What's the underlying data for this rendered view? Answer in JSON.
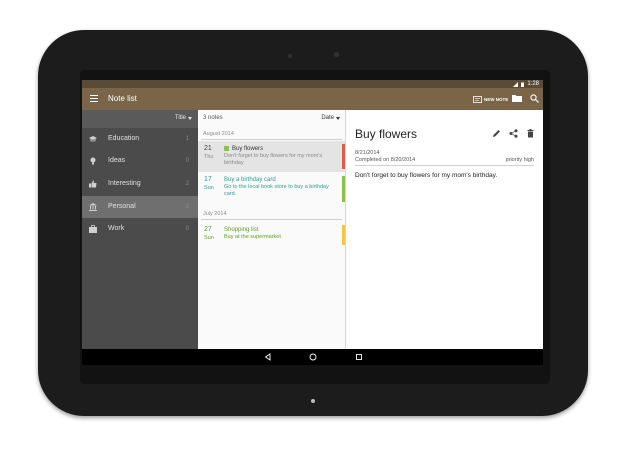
{
  "colors": {
    "status_bar": "#5a4b36",
    "app_bar": "#7a6548",
    "sidebar_bg": "#4b4b4b",
    "accent_red": "#e05a4a",
    "accent_green": "#8bc34a",
    "accent_yellow": "#f4c542",
    "teal_text": "#2a9d8f",
    "green_text": "#5a9e1f"
  },
  "status_bar": {
    "time": "1:28",
    "icons": [
      "signal-icon",
      "battery-icon"
    ]
  },
  "app_bar": {
    "title": "Note list",
    "new_note_label": "NEW NOTE",
    "icons": [
      "menu-icon",
      "new-note-icon",
      "folder-icon",
      "search-icon"
    ]
  },
  "sidebar": {
    "sort_label": "Title",
    "categories": [
      {
        "label": "Education",
        "count": "1",
        "icon": "education-icon"
      },
      {
        "label": "Ideas",
        "count": "0",
        "icon": "lightbulb-icon"
      },
      {
        "label": "Interesting",
        "count": "2",
        "icon": "thumbs-up-icon"
      },
      {
        "label": "Personal",
        "count": "3",
        "icon": "bank-icon",
        "selected": true
      },
      {
        "label": "Work",
        "count": "0",
        "icon": "briefcase-icon"
      }
    ]
  },
  "note_list": {
    "count_label": "3 notes",
    "sort_label": "Date",
    "groups": [
      {
        "month": "August 2014",
        "notes": [
          {
            "day": "21",
            "dow": "Thu",
            "title": "Buy flowers",
            "body": "Don't forget to buy flowers for my mom's birthday",
            "selected": true,
            "done": true
          },
          {
            "day": "17",
            "dow": "Sun",
            "title": "Buy a birthday card",
            "body": "Go to the local book store to buy a birthday card."
          }
        ]
      },
      {
        "month": "July 2014",
        "notes": [
          {
            "day": "27",
            "dow": "Sun",
            "title": "Shopping list",
            "body": "Buy at the supermarket"
          }
        ]
      }
    ]
  },
  "detail": {
    "title": "Buy flowers",
    "date": "8/21/2014",
    "completed": "Completed on 8/20/2014",
    "priority": "priority high",
    "body": "Don't forget to buy flowers for my mom's birthday.",
    "actions": [
      "edit-icon",
      "share-icon",
      "delete-icon"
    ]
  },
  "nav_bar": {
    "buttons": [
      "back-icon",
      "home-icon",
      "recents-icon"
    ]
  }
}
